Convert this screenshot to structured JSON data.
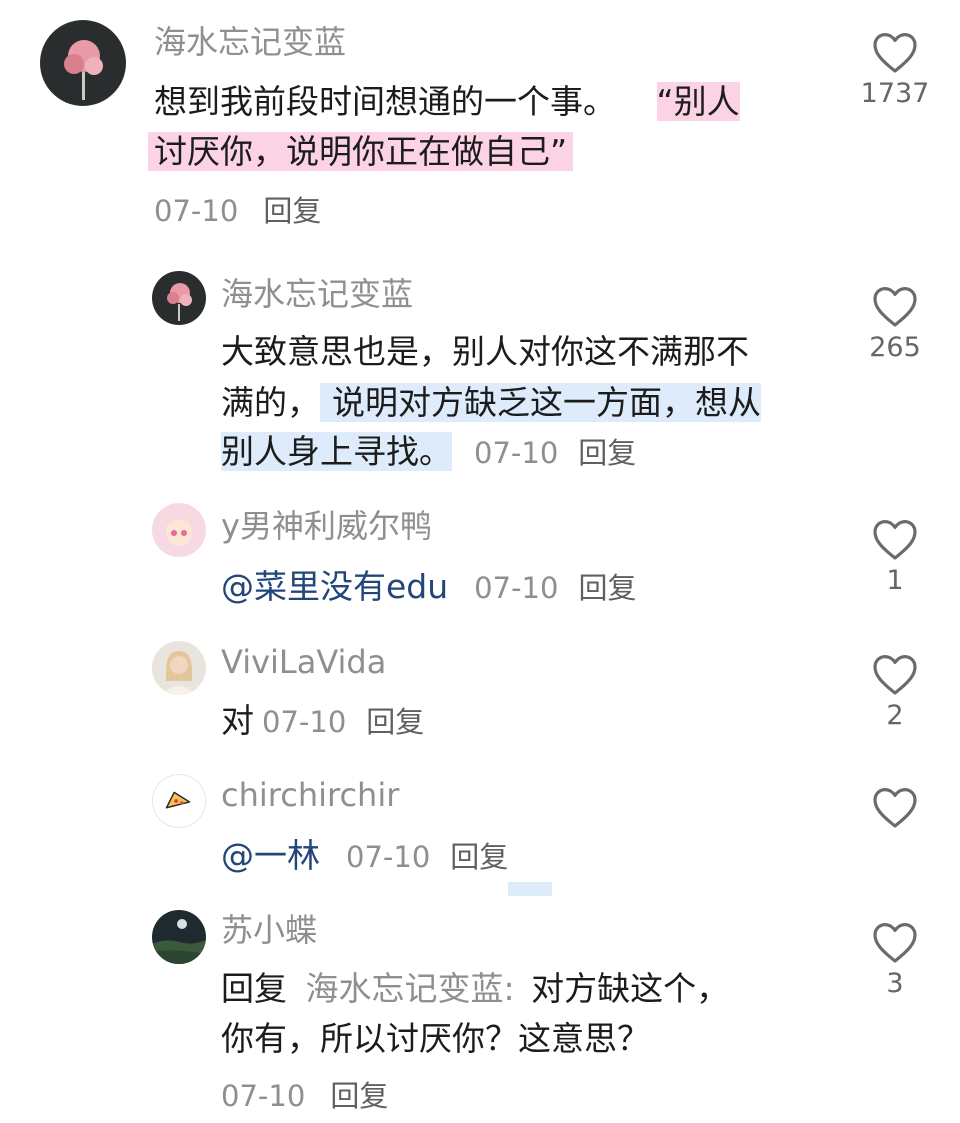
{
  "comments": [
    {
      "username": "海水忘记变蓝",
      "text_plain": "想到我前段时间想通的一个事。",
      "text_highlight_1": "“别人",
      "text_highlight_2": "讨厌你，说明你正在做自己”",
      "date": "07-10",
      "reply_label": "回复",
      "likes": "1737",
      "avatar_icon": "cotton-candy-avatar-icon"
    },
    {
      "username": "海水忘记变蓝",
      "text_line1": "大致意思也是，别人对你这不满那不",
      "text_line2_plain": "满的，",
      "text_line2_highlight": "说明对方缺乏这一方面，想从",
      "text_line3_highlight": "别人身上寻找。",
      "date": "07-10",
      "reply_label": "回复",
      "likes": "265",
      "avatar_icon": "cotton-candy-avatar-icon"
    },
    {
      "username": "y男神利威尔鸭",
      "mention": "@菜里没有edu",
      "date": "07-10",
      "reply_label": "回复",
      "likes": "1",
      "avatar_icon": "anime-girl-avatar-icon"
    },
    {
      "username": "ViviLaVida",
      "text": "对",
      "date": "07-10",
      "reply_label": "回复",
      "likes": "2",
      "avatar_icon": "woman-portrait-avatar-icon"
    },
    {
      "username": "chirchirchir",
      "mention": "@一林",
      "date": "07-10",
      "reply_label": "回复",
      "likes": "",
      "avatar_icon": "pizza-avatar-icon"
    },
    {
      "username": "苏小蝶",
      "reply_prefix": "回复",
      "reply_to": "海水忘记变蓝:",
      "text_line1": "对方缺这个，",
      "text_line2": "你有，所以讨厌你？这意思？",
      "date": "07-10",
      "reply_label": "回复",
      "likes": "3",
      "avatar_icon": "night-landscape-avatar-icon"
    }
  ],
  "colors": {
    "pink_highlight": "#fbd3e4",
    "blue_highlight": "#ddebfb",
    "username_gray": "#8f8f8f",
    "mention_blue": "#23467a"
  }
}
